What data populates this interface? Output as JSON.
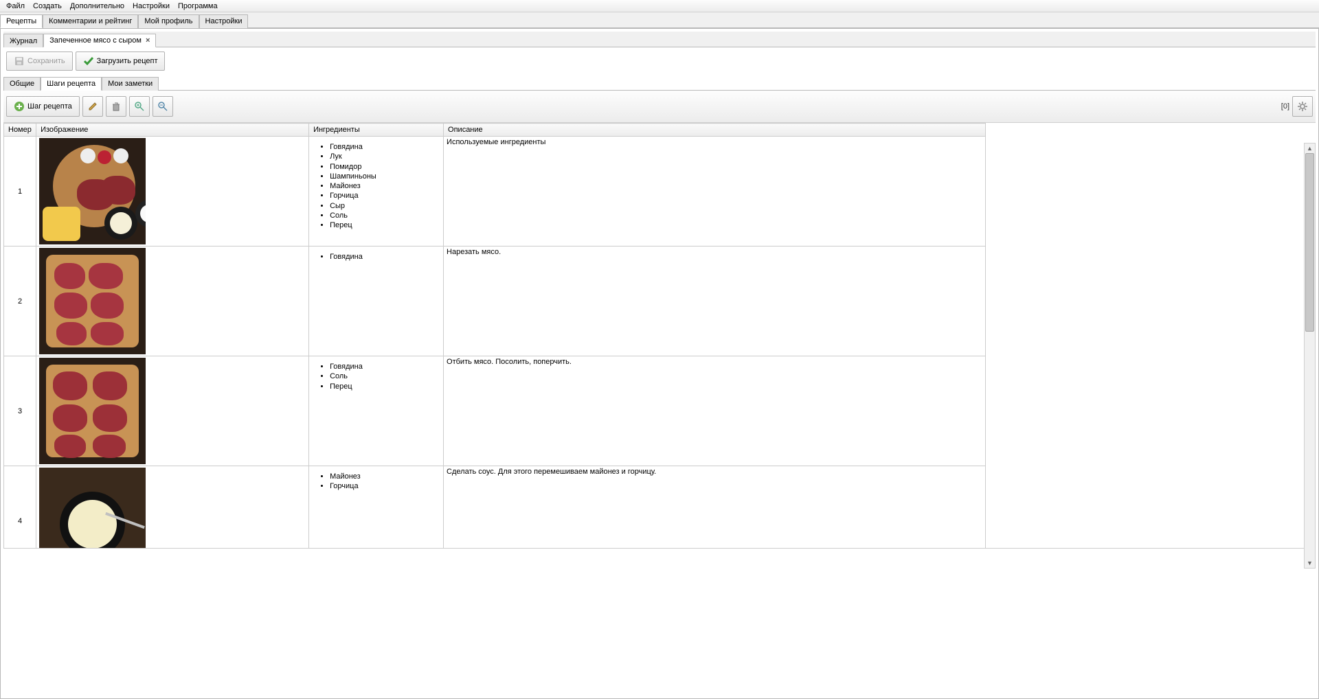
{
  "menu": [
    "Файл",
    "Создать",
    "Дополнительно",
    "Настройки",
    "Программа"
  ],
  "main_tabs": [
    {
      "label": "Рецепты",
      "active": true
    },
    {
      "label": "Комментарии и рейтинг",
      "active": false
    },
    {
      "label": "Мой профиль",
      "active": false
    },
    {
      "label": "Настройки",
      "active": false
    }
  ],
  "sub_tabs": [
    {
      "label": "Журнал",
      "active": false,
      "closable": false
    },
    {
      "label": "Запеченное мясо с сыром",
      "active": true,
      "closable": true
    }
  ],
  "toolbar": {
    "save": "Сохранить",
    "load": "Загрузить рецепт"
  },
  "recipe_tabs": [
    {
      "label": "Общие",
      "active": false
    },
    {
      "label": "Шаги рецепта",
      "active": true
    },
    {
      "label": "Мои заметки",
      "active": false
    }
  ],
  "step_button": "Шаг рецепта",
  "counter": "[0]",
  "columns": {
    "num": "Номер",
    "img": "Изображение",
    "ing": "Ингредиенты",
    "desc": "Описание"
  },
  "steps": [
    {
      "num": "1",
      "ingredients": [
        "Говядина",
        "Лук",
        "Помидор",
        "Шампиньоны",
        "Майонез",
        "Горчица",
        "Сыр",
        "Соль",
        "Перец"
      ],
      "description": "Используемые ингредиенты"
    },
    {
      "num": "2",
      "ingredients": [
        "Говядина"
      ],
      "description": "Нарезать мясо."
    },
    {
      "num": "3",
      "ingredients": [
        "Говядина",
        "Соль",
        "Перец"
      ],
      "description": "Отбить мясо. Посолить, поперчить."
    },
    {
      "num": "4",
      "ingredients": [
        "Майонез",
        "Горчица"
      ],
      "description": "Сделать соус. Для этого перемешиваем майонез и горчицу."
    }
  ]
}
